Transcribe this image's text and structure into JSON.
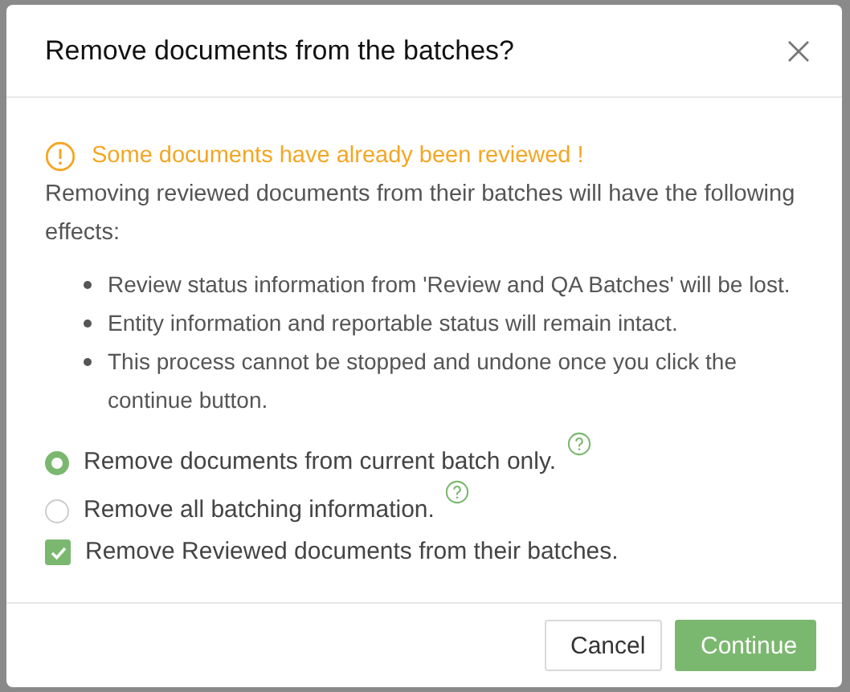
{
  "dialog": {
    "title": "Remove documents from the batches?",
    "warning": "Some documents have already been reviewed !",
    "intro": "Removing reviewed documents from their batches will have the following effects:",
    "effects": [
      "Review status information from 'Review and QA Batches' will be lost.",
      "Entity information and reportable status will remain intact.",
      "This process cannot be stopped and undone once you click the continue button."
    ],
    "options": [
      {
        "kind": "radio",
        "label": "Remove documents from current batch only.",
        "selected": true,
        "help": true
      },
      {
        "kind": "radio",
        "label": "Remove all batching information.",
        "selected": false,
        "help": true
      },
      {
        "kind": "checkbox",
        "label": "Remove Reviewed documents from their batches.",
        "checked": true,
        "help": false
      }
    ],
    "buttons": [
      {
        "label": "Cancel",
        "kind": "default"
      },
      {
        "label": "Continue",
        "kind": "primary"
      }
    ]
  }
}
